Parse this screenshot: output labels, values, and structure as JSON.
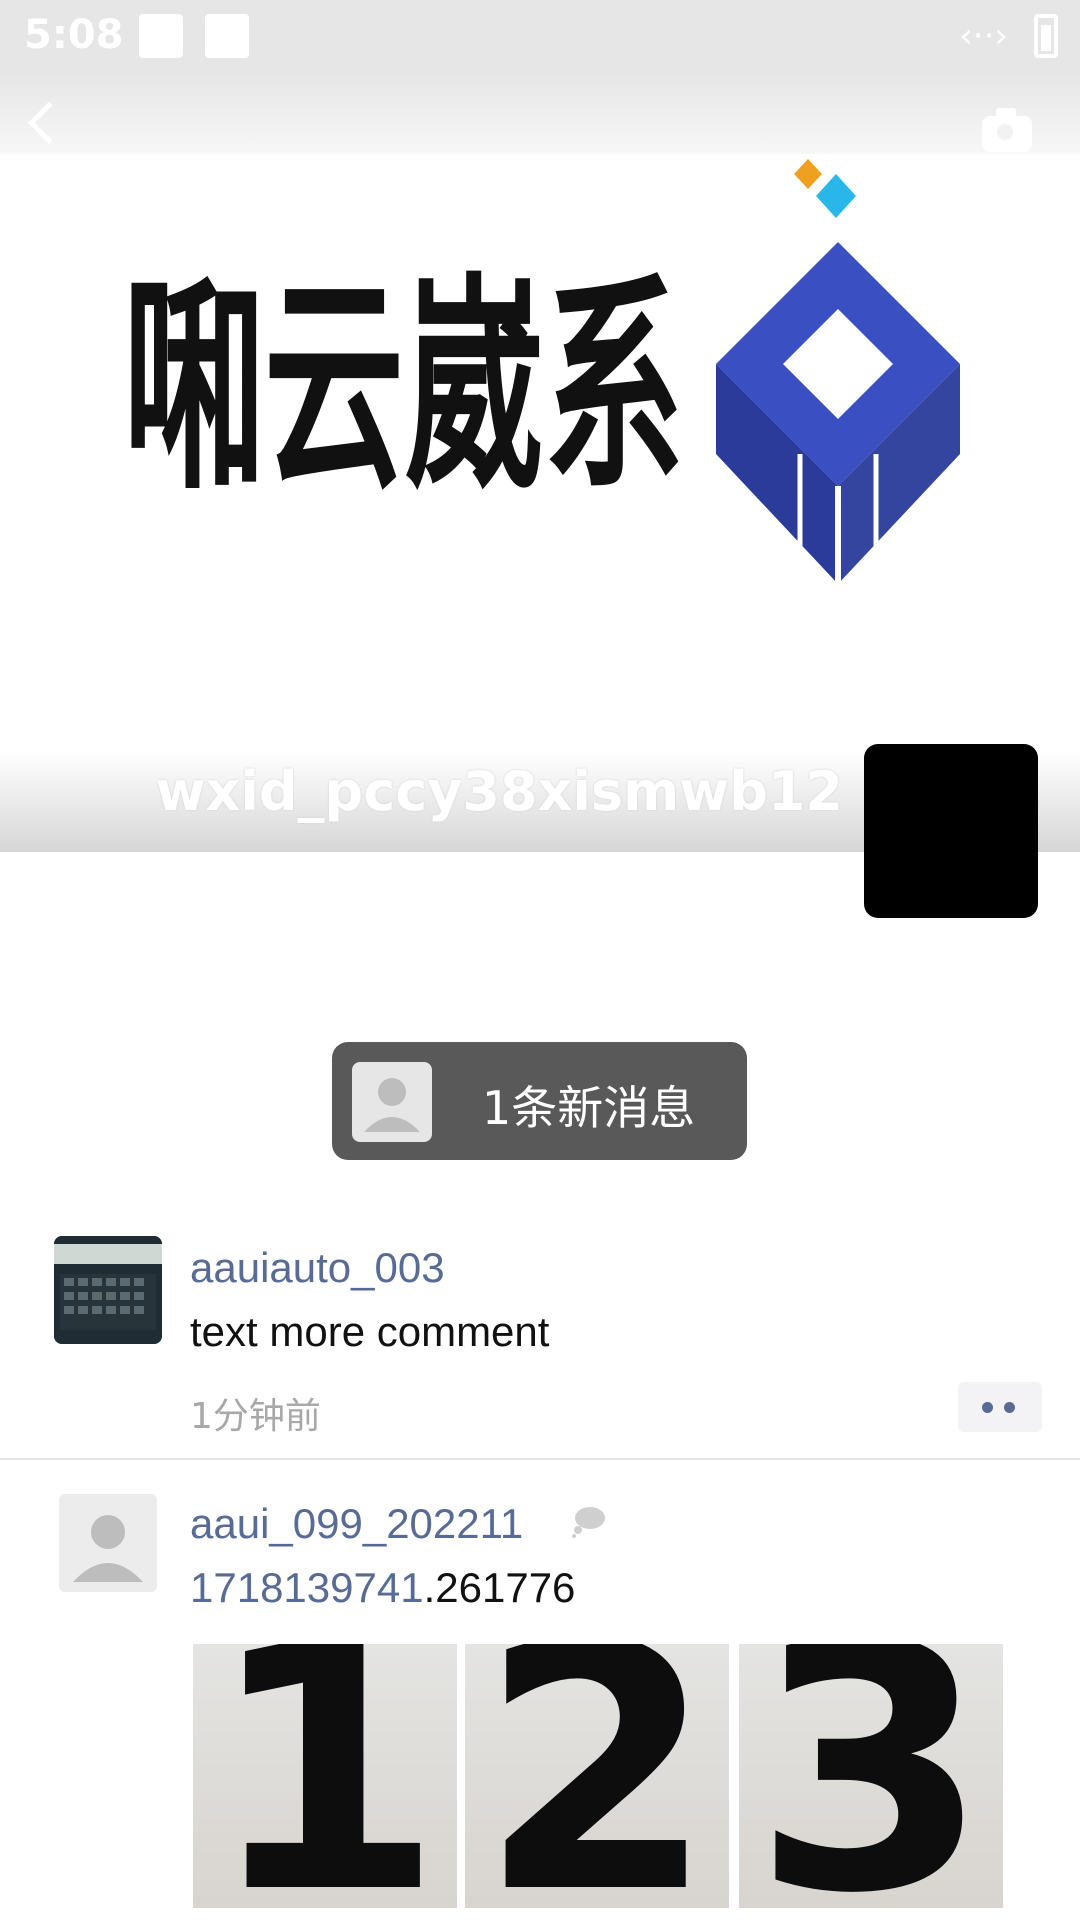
{
  "status_bar": {
    "time": "5:08",
    "link_icon": "‹··›"
  },
  "header": {
    "back_icon": "back-icon",
    "camera_icon": "camera-icon"
  },
  "cover": {
    "logo_text": "啝云崴系",
    "brand_colors": {
      "blue": "#3a4fc2",
      "dark_blue": "#2b3b9a",
      "orange": "#f0a020",
      "cyan": "#28b7e8"
    }
  },
  "profile": {
    "username": "wxid_pccy38xismwb12"
  },
  "new_message": {
    "label": "1条新消息"
  },
  "posts": [
    {
      "author": "aauiauto_003",
      "text": "text more comment",
      "time": "1分钟前"
    },
    {
      "author": "aaui_099_202211",
      "text_link": "1718139741",
      "text_rest": ".261776",
      "images": [
        "1",
        "2",
        "3"
      ]
    }
  ],
  "colors": {
    "link": "#576b95",
    "pill": "#595959",
    "meta": "#a8a8a8"
  }
}
